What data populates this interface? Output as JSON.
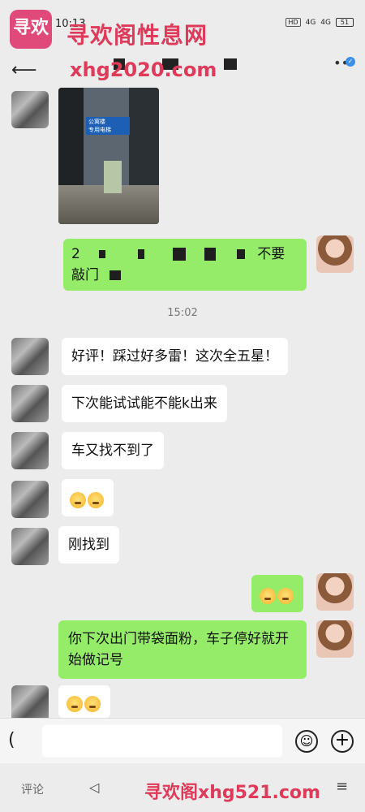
{
  "status": {
    "time": "10:13",
    "hd": "HD",
    "net1": "4G",
    "net2": "4G",
    "battery": "51"
  },
  "watermark": {
    "logo_text": "寻欢",
    "title": "寻欢阁性息网",
    "url": "xhg2020.com",
    "bottom_text": "寻欢阁xhg521.com"
  },
  "nav": {
    "back_icon": "arrow-left-icon",
    "menu_icon": "more-dots-icon"
  },
  "photo_sign": "公寓楼\n专用电梯",
  "messages": {
    "m2_lead": "2",
    "m2_tail": "不要",
    "m2_line2_lead": "敲门",
    "time_label": "15:02",
    "m3": "好评！踩过好多雷！这次全五星！",
    "m4": "下次能试试能不能k出来",
    "m5": "车又找不到了",
    "m6_icon": "flushed-face-emoji",
    "m7": "刚找到",
    "m8_icon": "rolling-eyes-emoji",
    "m9": "你下次出门带袋面粉，车子停好就开始做记号",
    "m10_icon": "grin-emoji"
  },
  "input": {
    "voice_icon": "voice-icon",
    "emoji_icon": "emoji-icon",
    "plus_icon": "plus-icon"
  },
  "bottom": {
    "comment": "评论",
    "back_icon": "triangle-back-icon",
    "menu_icon": "menu-lines-icon"
  }
}
